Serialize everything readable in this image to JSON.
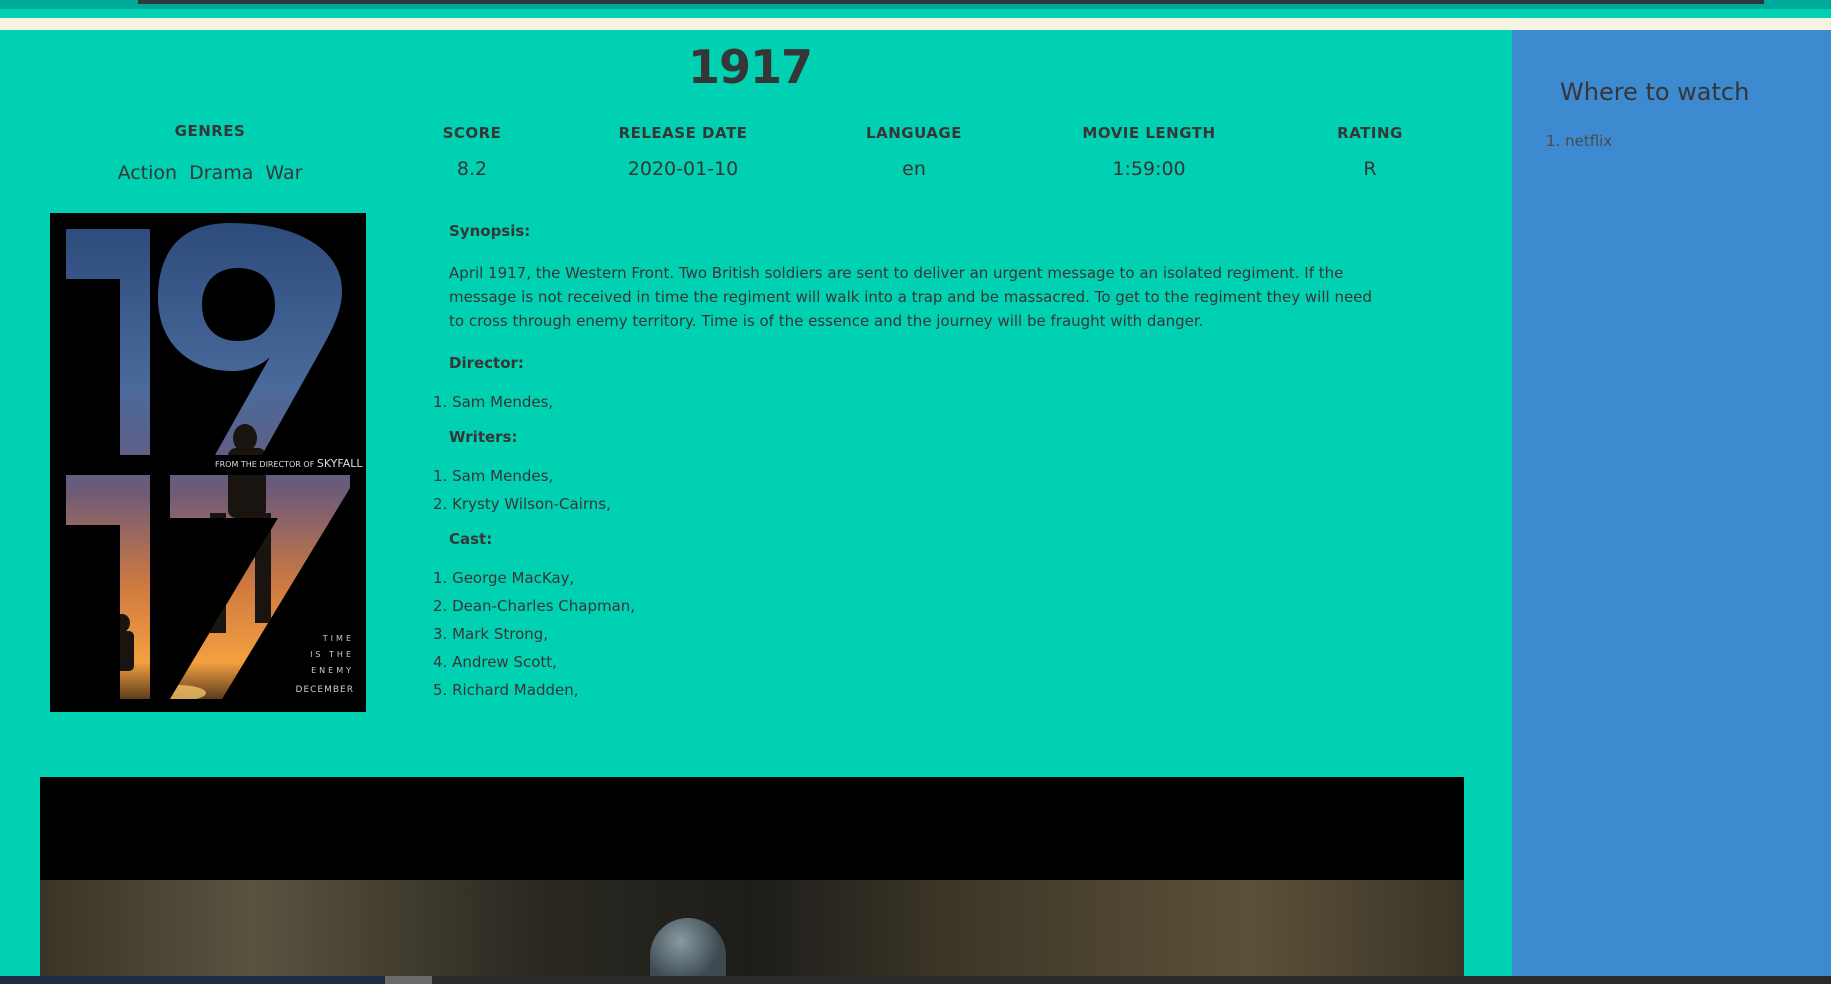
{
  "movie": {
    "title": "1917"
  },
  "info": {
    "genres": {
      "heading": "GENRES",
      "values": "Action Drama War"
    },
    "score": {
      "heading": "SCORE",
      "value": "8.2"
    },
    "release_date": {
      "heading": "RELEASE DATE",
      "value": "2020-01-10"
    },
    "language": {
      "heading": "LANGUAGE",
      "value": "en"
    },
    "movie_length": {
      "heading": "MOVIE LENGTH",
      "value": "1:59:00"
    },
    "rating": {
      "heading": "RATING",
      "value": "R"
    }
  },
  "poster": {
    "top_digits": "19",
    "bottom_digits": "17",
    "tagline_small": "FROM THE DIRECTOR OF",
    "tagline_big": "SKYFALL",
    "time_enemy": [
      "TIME",
      "IS THE",
      "ENEMY"
    ],
    "month": "DECEMBER"
  },
  "details": {
    "synopsis_label": "Synopsis:",
    "synopsis": "April 1917, the Western Front. Two British soldiers are sent to deliver an urgent message to an isolated regiment. If the message is not received in time the regiment will walk into a trap and be massacred. To get to the regiment they will need to cross through enemy territory. Time is of the essence and the journey will be fraught with danger.",
    "director_label": "Director:",
    "directors": [
      "1. Sam Mendes,"
    ],
    "writers_label": "Writers:",
    "writers": [
      "1. Sam Mendes,",
      "2. Krysty Wilson-Cairns,"
    ],
    "cast_label": "Cast:",
    "cast": [
      "1. George MacKay,",
      "2. Dean-Charles Chapman,",
      "3. Mark Strong,",
      "4. Andrew Scott,",
      "5. Richard Madden,"
    ]
  },
  "sidebar": {
    "title": "Where to watch",
    "providers": [
      "1. netflix"
    ]
  },
  "colors": {
    "main_bg": "#00d1b2",
    "sidebar_bg": "#3d8ad1",
    "text": "#363636"
  }
}
